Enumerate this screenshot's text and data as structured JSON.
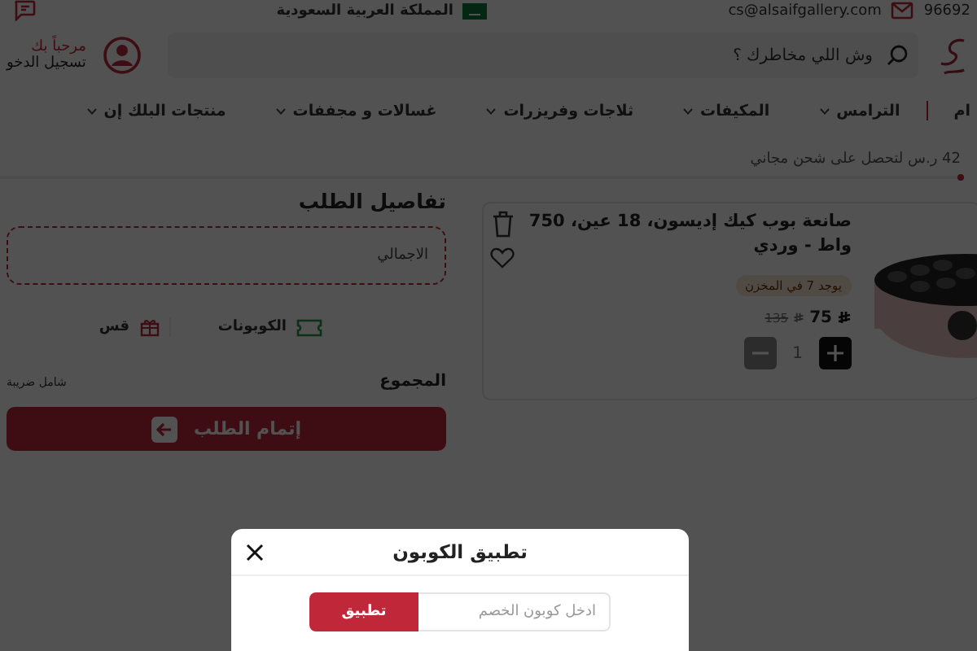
{
  "top_bar": {
    "phone": "96692",
    "email": "cs@alsaifgallery.com",
    "country": "المملكة العربية السعودية"
  },
  "header": {
    "search": {
      "placeholder": "وش اللي مخاطرك ؟"
    },
    "greeting": "مرحباً بك",
    "login": "تسجيل الدخو"
  },
  "nav": [
    {
      "label": "ام",
      "dropdown": false
    },
    {
      "label": "الترامس",
      "dropdown": true
    },
    {
      "label": "المكيفات",
      "dropdown": true
    },
    {
      "label": "ثلاجات وفريزرات",
      "dropdown": true
    },
    {
      "label": "غسالات و مجففات",
      "dropdown": true
    },
    {
      "label": "منتجات البلك إن",
      "dropdown": true
    }
  ],
  "shipping_note": "42 ر.س لتحصل على شحن مجاني",
  "cart_item": {
    "title": "صانعة بوب كيك إديسون، 18 عين، 750 واط - وردي",
    "stock": "يوجد 7 في المخزن",
    "price": "75",
    "old_price": "135",
    "quantity": "1"
  },
  "order": {
    "title": "تفاصيل الطلب",
    "total_label": "الاجمالي",
    "coupons": "الكوبونات",
    "gift": "قس",
    "sum_label": "المجموع",
    "tax_note": "شامل ضريبة",
    "checkout": "إتمام الطلب"
  },
  "modal": {
    "title": "تطبيق الكوبون",
    "input": {
      "placeholder": "ادخل كوبون الخصم"
    },
    "apply": "تطبيق"
  }
}
